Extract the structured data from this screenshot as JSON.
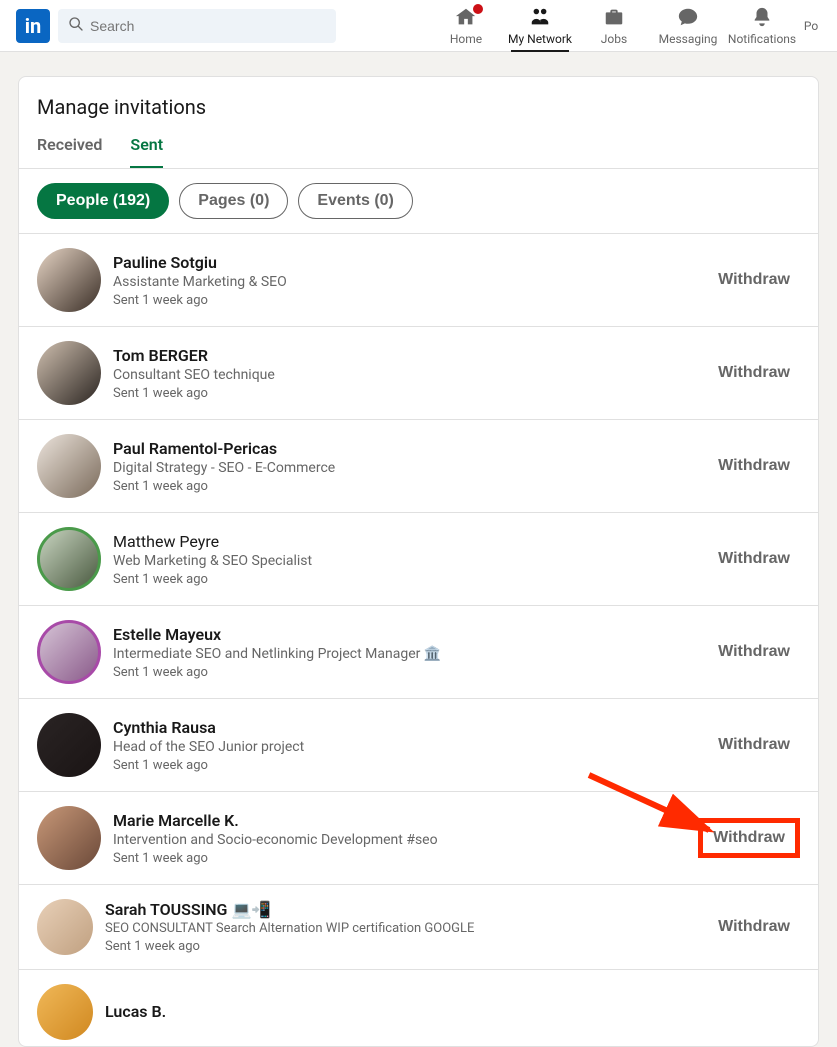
{
  "header": {
    "search_placeholder": "Search",
    "nav": {
      "home": "Home",
      "network": "My Network",
      "jobs": "Jobs",
      "messaging": "Messaging",
      "notifications": "Notifications",
      "post_fragment": "Po"
    }
  },
  "page": {
    "title": "Manage invitations",
    "tabs": {
      "received": "Received",
      "sent": "Sent"
    },
    "pills": {
      "people": "People (192)",
      "pages": "Pages (0)",
      "events": "Events (0)"
    },
    "withdraw_label": "Withdraw",
    "invites": [
      {
        "name": "Pauline Sotgiu",
        "headline": "Assistante Marketing & SEO",
        "time": "Sent 1 week ago"
      },
      {
        "name": "Tom BERGER",
        "headline": "Consultant SEO technique",
        "time": "Sent 1 week ago"
      },
      {
        "name": "Paul Ramentol-Pericas",
        "headline": "Digital Strategy - SEO - E-Commerce",
        "time": "Sent 1 week ago"
      },
      {
        "name": "Matthew Peyre",
        "headline": "Web Marketing & SEO Specialist",
        "time": "Sent 1 week ago"
      },
      {
        "name": "Estelle Mayeux",
        "headline": "Intermediate SEO and Netlinking Project Manager       🏛️",
        "time": "Sent 1 week ago"
      },
      {
        "name": "Cynthia Rausa",
        "headline": "Head of the SEO Junior project",
        "time": "Sent 1 week ago"
      },
      {
        "name": "Marie Marcelle K.",
        "headline": "Intervention and Socio-economic Development #seo",
        "time": "Sent 1 week ago"
      },
      {
        "name": "Sarah TOUSSING 💻📲",
        "headline": "SEO CONSULTANT Search Alternation WIP certification GOOGLE",
        "time": "Sent 1 week ago"
      },
      {
        "name": "Lucas B.",
        "headline": "",
        "time": ""
      }
    ]
  }
}
